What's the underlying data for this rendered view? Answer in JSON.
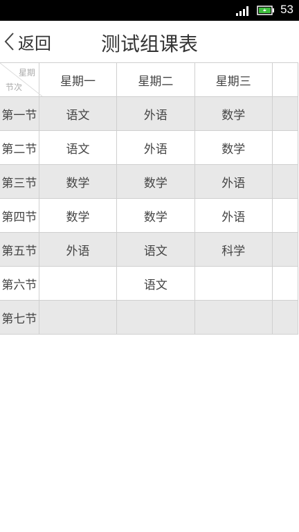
{
  "status": {
    "clock": "53",
    "signal_icon": "signal-icon",
    "battery_icon": "battery-charging-icon"
  },
  "header": {
    "back_label": "返回",
    "title": "测试组课表"
  },
  "table": {
    "corner_top": "星期",
    "corner_bottom": "节次",
    "days": [
      "星期一",
      "星期二",
      "星期三"
    ],
    "rows": [
      {
        "label": "第一节",
        "cells": [
          "语文",
          "外语",
          "数学"
        ]
      },
      {
        "label": "第二节",
        "cells": [
          "语文",
          "外语",
          "数学"
        ]
      },
      {
        "label": "第三节",
        "cells": [
          "数学",
          "数学",
          "外语"
        ]
      },
      {
        "label": "第四节",
        "cells": [
          "数学",
          "数学",
          "外语"
        ]
      },
      {
        "label": "第五节",
        "cells": [
          "外语",
          "语文",
          "科学"
        ]
      },
      {
        "label": "第六节",
        "cells": [
          "",
          "语文",
          ""
        ]
      },
      {
        "label": "第七节",
        "cells": [
          "",
          "",
          ""
        ]
      }
    ]
  }
}
